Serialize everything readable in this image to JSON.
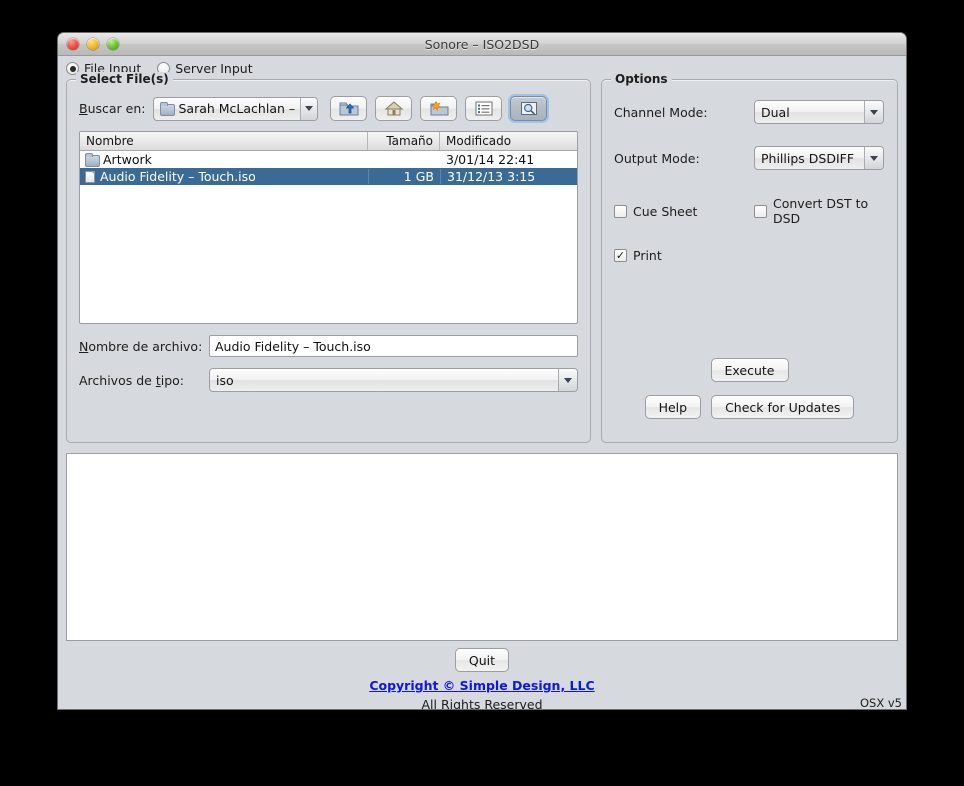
{
  "window": {
    "title": "Sonore – ISO2DSD",
    "traffic_lights": [
      "close-button",
      "minimize-button",
      "zoom-button"
    ]
  },
  "mode": {
    "options": [
      {
        "label": "File Input",
        "selected": true
      },
      {
        "label": "Server Input",
        "selected": false
      }
    ]
  },
  "select_files": {
    "group_title": "Select File(s)",
    "look_in_label": "Buscar en:",
    "look_in_label_mnemonic": "B",
    "look_in_value": "Sarah McLachlan – ...",
    "toolbar": [
      {
        "name": "up-folder-icon",
        "tooltip": "Up One Level",
        "selected": false
      },
      {
        "name": "home-icon",
        "tooltip": "Home",
        "selected": false
      },
      {
        "name": "new-folder-icon",
        "tooltip": "Create New Folder",
        "selected": false
      },
      {
        "name": "list-view-icon",
        "tooltip": "List",
        "selected": false
      },
      {
        "name": "details-view-icon",
        "tooltip": "Details",
        "selected": true
      }
    ],
    "table": {
      "columns": [
        "Nombre",
        "Tamaño",
        "Modificado"
      ],
      "rows": [
        {
          "icon": "folder-icon",
          "name": "Artwork",
          "size": "",
          "modified": "3/01/14 22:41",
          "selected": false
        },
        {
          "icon": "file-icon",
          "name": "Audio Fidelity – Touch.iso",
          "size": "1 GB",
          "modified": "31/12/13 3:15",
          "selected": true
        }
      ]
    },
    "file_name_label": "Nombre de archivo:",
    "file_name_mnemonic": "N",
    "file_name_value": "Audio Fidelity – Touch.iso",
    "file_type_label": "Archivos de tipo:",
    "file_type_mnemonic": "t",
    "file_type_value": "iso"
  },
  "options": {
    "group_title": "Options",
    "channel_mode_label": "Channel Mode:",
    "channel_mode_value": "Dual",
    "output_mode_label": "Output Mode:",
    "output_mode_value": "Phillips DSDIFF",
    "cue_sheet_label": "Cue Sheet",
    "cue_sheet_checked": false,
    "convert_dst_label": "Convert DST to DSD",
    "convert_dst_checked": false,
    "print_label": "Print",
    "print_checked": true,
    "print_mark": "✓",
    "execute_label": "Execute",
    "help_label": "Help",
    "check_updates_label": "Check for Updates"
  },
  "footer": {
    "quit_label": "Quit",
    "copyright": "Copyright © Simple Design, LLC",
    "rights": "All Rights Reserved",
    "version": "OSX v5"
  },
  "colors": {
    "selection_blue": "#3a6a96",
    "link_blue": "#0b16e8",
    "window_bg": "#d6d9de"
  }
}
